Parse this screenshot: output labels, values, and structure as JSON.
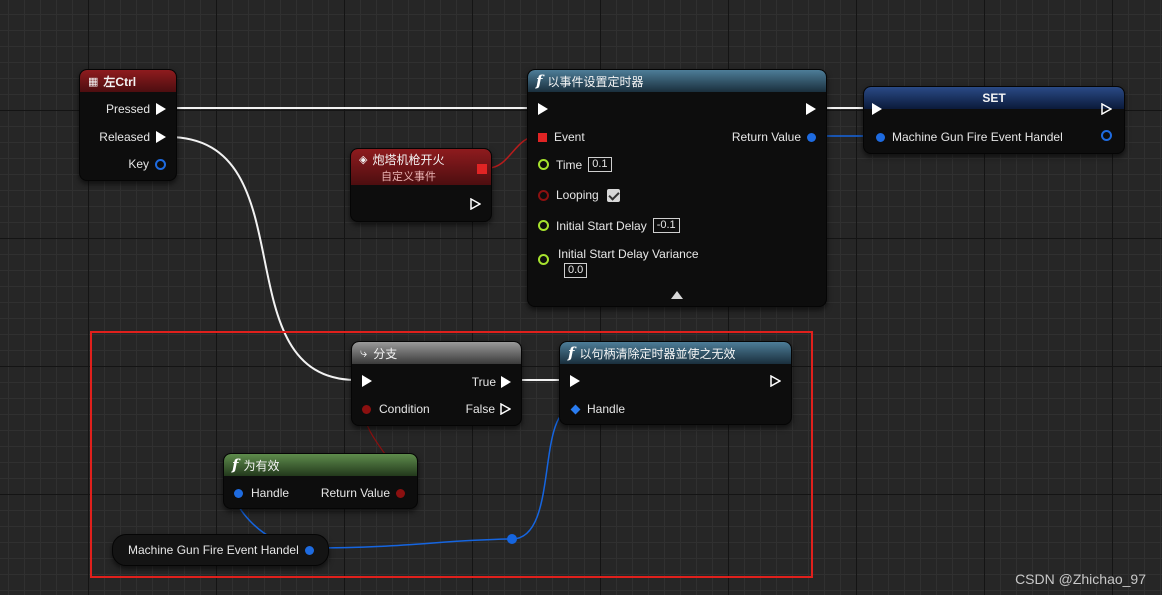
{
  "colors": {
    "exec": "#ffffff",
    "event_pin": "#e02424",
    "float_pin": "#a6e22e",
    "bool_pin": "#8b1010",
    "struct_pin": "#1e6be0",
    "selection": "#e0201c"
  },
  "key_node": {
    "icon": "keyboard-icon",
    "title": "左Ctrl",
    "pressed": "Pressed",
    "released": "Released",
    "key": "Key"
  },
  "custom_event": {
    "icon": "event-icon",
    "title": "炮塔机枪开火",
    "subtitle": "自定义事件"
  },
  "set_timer_node": {
    "title": "以事件设置定时器",
    "event": "Event",
    "return_value": "Return Value",
    "time": "Time",
    "time_value": "0.1",
    "looping": "Looping",
    "looping_checked": true,
    "initial_start_delay": "Initial Start Delay",
    "initial_start_delay_value": "-0.1",
    "initial_start_delay_variance": "Initial Start Delay Variance",
    "initial_start_delay_variance_value": "0.0"
  },
  "set_node": {
    "title": "SET",
    "variable": "Machine Gun Fire Event Handel"
  },
  "branch_node": {
    "icon": "branch-icon",
    "title": "分支",
    "condition": "Condition",
    "true_label": "True",
    "false_label": "False"
  },
  "clear_timer_node": {
    "title": "以句柄清除定时器並使之无效",
    "handle": "Handle"
  },
  "is_valid_node": {
    "title": "为有效",
    "handle": "Handle",
    "return_value": "Return Value"
  },
  "variable_getter": {
    "label": "Machine Gun Fire Event Handel"
  },
  "watermark": "CSDN @Zhichao_97"
}
